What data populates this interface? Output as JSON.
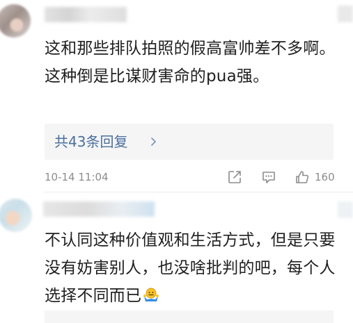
{
  "comments": [
    {
      "text": "这和那些排队拍照的假高富帅差不多啊。这种倒是比谋财害命的pua强。",
      "replies_label": "共43条回复",
      "timestamp": "10-14 11:04",
      "like_count": "160"
    },
    {
      "text": "不认同这种价值观和生活方式，但是只要没有妨害别人，也没啥批判的吧，每个人选择不同而已",
      "emoji": "shrug-emoji"
    }
  ],
  "icons": {
    "share": "share-icon",
    "comment": "comment-icon",
    "like": "thumbs-up-icon",
    "chevron": "chevron-right-icon"
  },
  "colors": {
    "link": "#4a6f9d",
    "meta": "#8c8c8c",
    "reply_bg": "#f5f5f5"
  }
}
